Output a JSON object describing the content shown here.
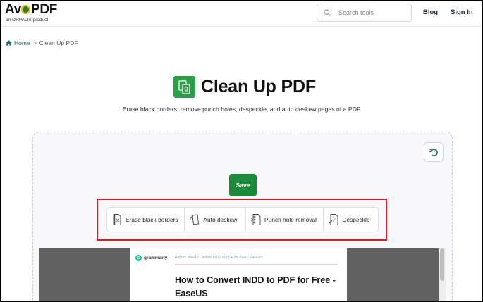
{
  "header": {
    "logo_text_1": "Av",
    "logo_text_2": "PDF",
    "logo_sub": "an ORPALIS product",
    "search_placeholder": "Search tools",
    "nav": {
      "blog": "Blog",
      "sign_in": "Sign In"
    }
  },
  "breadcrumb": {
    "home": "Home",
    "separator": ">",
    "current": "Clean Up PDF"
  },
  "page": {
    "title": "Clean Up PDF",
    "subtitle": "Erase black borders, remove punch holes, despeckle, and auto deskew pages of a PDF"
  },
  "editor": {
    "save_label": "Save",
    "tools": [
      {
        "label": "Erase black borders",
        "icon": "erase-borders-icon"
      },
      {
        "label": "Auto deskew",
        "icon": "deskew-icon"
      },
      {
        "label": "Punch hole removal",
        "icon": "punch-hole-icon"
      },
      {
        "label": "Despeckle",
        "icon": "despeckle-icon"
      }
    ]
  },
  "preview": {
    "brand": "grammarly",
    "report": "Report: How to Convert INDD to PDF for Free - EaseUS",
    "title": "How to Convert INDD to PDF for Free - EaseUS"
  },
  "colors": {
    "accent_green": "#1b8a3a",
    "title_icon_green": "#2e9e4a",
    "link_teal": "#1b6f6a",
    "highlight_red": "#e01a1a",
    "viewer_gray": "#616161"
  }
}
